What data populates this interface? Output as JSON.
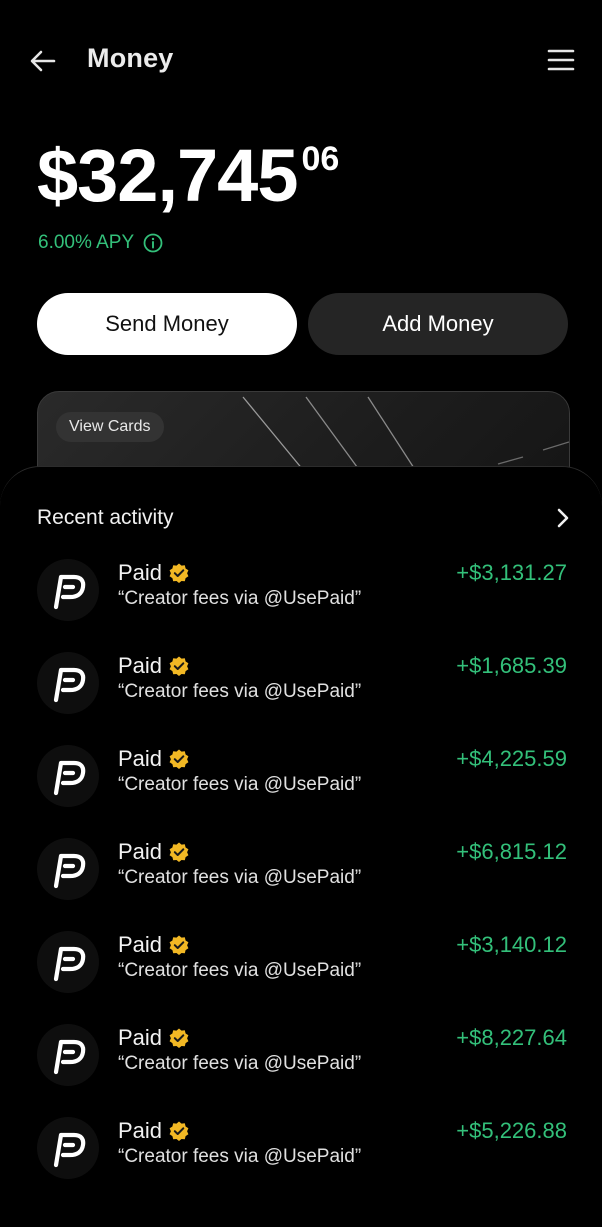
{
  "header": {
    "title": "Money"
  },
  "balance": {
    "main": "$32,745",
    "cents": "06"
  },
  "apy": {
    "label": "6.00% APY"
  },
  "actions": {
    "send_label": "Send Money",
    "add_label": "Add Money"
  },
  "card": {
    "view_cards_label": "View Cards"
  },
  "recent": {
    "title": "Recent activity",
    "items": [
      {
        "name": "Paid",
        "memo": "“Creator fees via @UsePaid”",
        "amount": "+$3,131.27"
      },
      {
        "name": "Paid",
        "memo": "“Creator fees via @UsePaid”",
        "amount": "+$1,685.39"
      },
      {
        "name": "Paid",
        "memo": "“Creator fees via @UsePaid”",
        "amount": "+$4,225.59"
      },
      {
        "name": "Paid",
        "memo": "“Creator fees via @UsePaid”",
        "amount": "+$6,815.12"
      },
      {
        "name": "Paid",
        "memo": "“Creator fees via @UsePaid”",
        "amount": "+$3,140.12"
      },
      {
        "name": "Paid",
        "memo": "“Creator fees via @UsePaid”",
        "amount": "+$8,227.64"
      },
      {
        "name": "Paid",
        "memo": "“Creator fees via @UsePaid”",
        "amount": "+$5,226.88"
      }
    ]
  },
  "icons": {
    "back": "arrow-left-icon",
    "menu": "hamburger-menu-icon",
    "info": "info-icon",
    "chevron": "chevron-right-icon",
    "verified": "verified-badge-icon",
    "avatar": "paid-logo-icon"
  },
  "colors": {
    "accent_green": "#33c07a",
    "verified_gold": "#f2b824",
    "background": "#000000"
  }
}
